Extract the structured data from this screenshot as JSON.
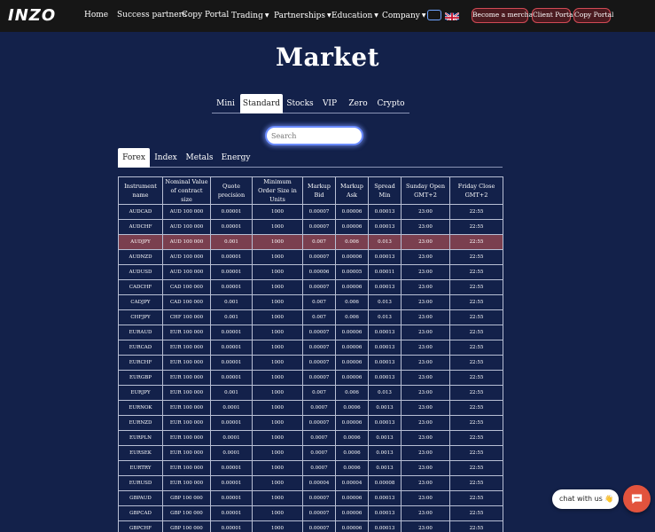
{
  "brand": {
    "logo_text": "INZO"
  },
  "nav": {
    "items": [
      {
        "label": "Home",
        "dropdown": false
      },
      {
        "label": "Success partners",
        "dropdown": false
      },
      {
        "label": "Copy Portal",
        "dropdown": false
      },
      {
        "label": "Trading",
        "dropdown": true
      },
      {
        "label": "Partnerships",
        "dropdown": true
      },
      {
        "label": "Education",
        "dropdown": true
      },
      {
        "label": "Company",
        "dropdown": true
      }
    ],
    "language_icon": "uk-flag-icon",
    "buttons": [
      "Become a merchant",
      "Client Portal",
      "Copy Portal"
    ]
  },
  "page": {
    "title": "Market"
  },
  "account_tabs": [
    "Mini",
    "Standard",
    "Stocks",
    "VIP",
    "Zero",
    "Crypto"
  ],
  "active_account_tab": "Standard",
  "search": {
    "placeholder": "Search",
    "value": ""
  },
  "category_tabs": [
    "Forex",
    "Index",
    "Metals",
    "Energy"
  ],
  "active_category_tab": "Forex",
  "table": {
    "headers": [
      "Instrument name",
      "Nominal Value of contract size",
      "Quote precision",
      "Minimum Order Size in Units",
      "Markup Bid",
      "Markup Ask",
      "Spread Min",
      "Sunday Open GMT+2",
      "Friday Close GMT+2"
    ],
    "rows": [
      [
        "AUDCAD",
        "AUD 100 000",
        "0.00001",
        "1000",
        "0.00007",
        "0.00006",
        "0.00013",
        "23:00",
        "22:55"
      ],
      [
        "AUDCHF",
        "AUD 100 000",
        "0.00001",
        "1000",
        "0.00007",
        "0.00006",
        "0.00013",
        "23:00",
        "22:55"
      ],
      [
        "AUDJPY",
        "AUD 100 000",
        "0.001",
        "1000",
        "0.007",
        "0.006",
        "0.013",
        "23:00",
        "22:55"
      ],
      [
        "AUDNZD",
        "AUD 100 000",
        "0.00001",
        "1000",
        "0.00007",
        "0.00006",
        "0.00013",
        "23:00",
        "22:55"
      ],
      [
        "AUDUSD",
        "AUD 100 000",
        "0.00001",
        "1000",
        "0.00006",
        "0.00005",
        "0.00011",
        "23:00",
        "22:55"
      ],
      [
        "CADCHF",
        "CAD 100 000",
        "0.00001",
        "1000",
        "0.00007",
        "0.00006",
        "0.00013",
        "23:00",
        "22:55"
      ],
      [
        "CADJPY",
        "CAD 100 000",
        "0.001",
        "1000",
        "0.007",
        "0.006",
        "0.013",
        "23:00",
        "22:55"
      ],
      [
        "CHFJPY",
        "CHF 100 000",
        "0.001",
        "1000",
        "0.007",
        "0.006",
        "0.013",
        "23:00",
        "22:55"
      ],
      [
        "EURAUD",
        "EUR 100 000",
        "0.00001",
        "1000",
        "0.00007",
        "0.00006",
        "0.00013",
        "23:00",
        "22:55"
      ],
      [
        "EURCAD",
        "EUR 100 000",
        "0.00001",
        "1000",
        "0.00007",
        "0.00006",
        "0.00013",
        "23:00",
        "22:55"
      ],
      [
        "EURCHF",
        "EUR 100 000",
        "0.00001",
        "1000",
        "0.00007",
        "0.00006",
        "0.00013",
        "23:00",
        "22:55"
      ],
      [
        "EURGBP",
        "EUR 100 000",
        "0.00001",
        "1000",
        "0.00007",
        "0.00006",
        "0.00013",
        "23:00",
        "22:55"
      ],
      [
        "EURJPY",
        "EUR 100 000",
        "0.001",
        "1000",
        "0.007",
        "0.006",
        "0.013",
        "23:00",
        "22:55"
      ],
      [
        "EURNOK",
        "EUR 100 000",
        "0.0001",
        "1000",
        "0.0007",
        "0.0006",
        "0.0013",
        "23:00",
        "22:55"
      ],
      [
        "EURNZD",
        "EUR 100 000",
        "0.00001",
        "1000",
        "0.00007",
        "0.00006",
        "0.00013",
        "23:00",
        "22:55"
      ],
      [
        "EURPLN",
        "EUR 100 000",
        "0.0001",
        "1000",
        "0.0007",
        "0.0006",
        "0.0013",
        "23:00",
        "22:55"
      ],
      [
        "EURSEK",
        "EUR 100 000",
        "0.0001",
        "1000",
        "0.0007",
        "0.0006",
        "0.0013",
        "23:00",
        "22:55"
      ],
      [
        "EURTRY",
        "EUR 100 000",
        "0.00001",
        "1000",
        "0.0007",
        "0.0006",
        "0.0013",
        "23:00",
        "22:55"
      ],
      [
        "EURUSD",
        "EUR 100 000",
        "0.00001",
        "1000",
        "0.00004",
        "0.00004",
        "0.00008",
        "23:00",
        "22:55"
      ],
      [
        "GBPAUD",
        "GBP 100 000",
        "0.00001",
        "1000",
        "0.00007",
        "0.00006",
        "0.00013",
        "23:00",
        "22:55"
      ],
      [
        "GBPCAD",
        "GBP 100 000",
        "0.00001",
        "1000",
        "0.00007",
        "0.00006",
        "0.00013",
        "23:00",
        "22:55"
      ],
      [
        "GBPCHF",
        "GBP 100 000",
        "0.00001",
        "1000",
        "0.00007",
        "0.00006",
        "0.00013",
        "23:00",
        "22:55"
      ]
    ],
    "highlighted_row": "AUDJPY"
  },
  "chat": {
    "label": "chat with us",
    "emoji": "👋",
    "button_icon": "chat-icon"
  },
  "colors": {
    "page_bg": "#13214a",
    "navbar_bg": "#161616",
    "highlight_row": "#7a3f4f",
    "pill_border": "#d14a55",
    "chat_button": "#e2533d"
  }
}
